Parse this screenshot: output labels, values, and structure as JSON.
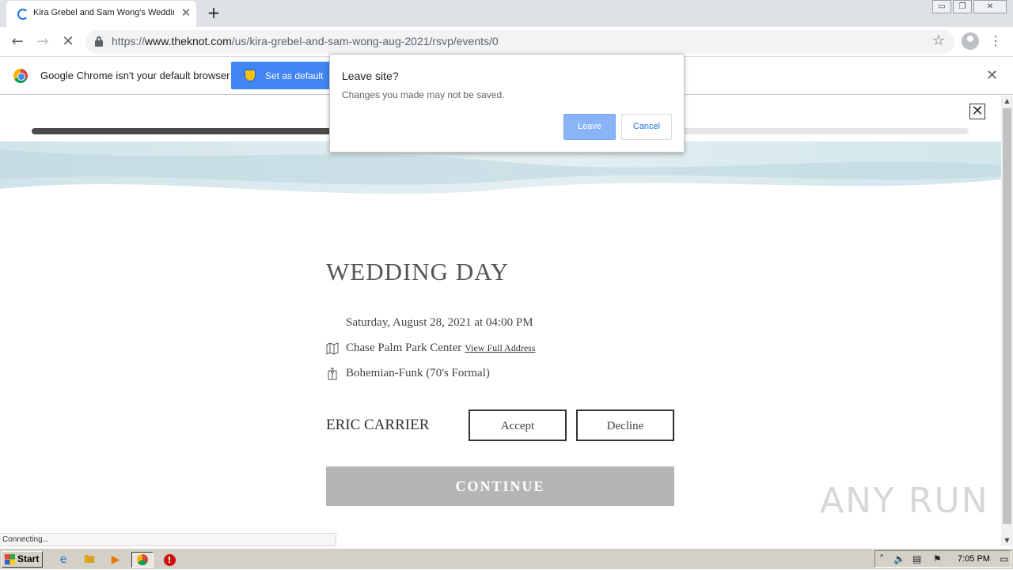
{
  "browser": {
    "tab_title": "Kira Grebel and Sam Wong's Wedding",
    "tab_close": "✕",
    "new_tab": "+",
    "url_prefix": "https://",
    "url_host": "www.theknot.com",
    "url_path": "/us/kira-grebel-and-sam-wong-aug-2021/rsvp/events/0",
    "window_buttons": {
      "minimize": "▭",
      "restore": "❐",
      "close": "✕"
    }
  },
  "infobar": {
    "message": "Google Chrome isn't your default browser",
    "button_label": "Set as default",
    "dismiss": "✕"
  },
  "dialog": {
    "title": "Leave site?",
    "message": "Changes you made may not be saved.",
    "leave_label": "Leave",
    "cancel_label": "Cancel"
  },
  "page": {
    "progress_fraction": 0.32,
    "close_glyph": "✕",
    "event_title": "WEDDING DAY",
    "date": "Saturday, August 28, 2021 at 04:00 PM",
    "venue": "Chase Palm Park Center",
    "venue_link": "View Full Address",
    "dress_code": "Bohemian-Funk (70's Formal)",
    "guest_name": "ERIC CARRIER",
    "accept_label": "Accept",
    "decline_label": "Decline",
    "continue_label": "CONTINUE"
  },
  "status_text": "Connecting...",
  "watermark": "ANY RUN",
  "taskbar": {
    "start_label": "Start",
    "clock": "7:05 PM"
  }
}
